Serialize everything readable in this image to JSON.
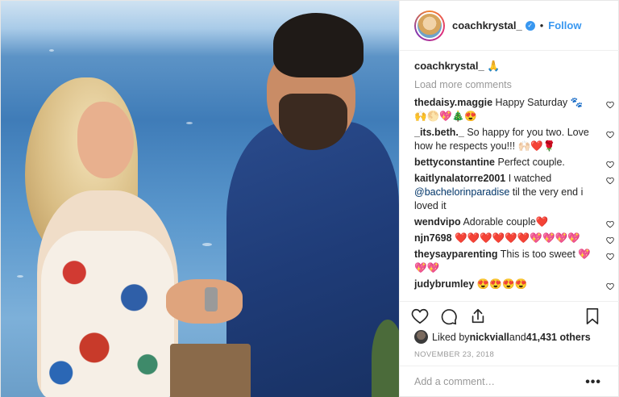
{
  "post": {
    "author": "coachkrystal_",
    "follow_label": "Follow",
    "separator": "•",
    "caption_user": "coachkrystal_",
    "caption_text": "🙏",
    "load_more": "Load more comments"
  },
  "comments": [
    {
      "user": "thedaisy.maggie",
      "text": "Happy Saturday 🐾 🙌🌕💖🎄😍"
    },
    {
      "user": "_its.beth._",
      "text": "So happy for you two. Love how he respects you!!! 🙌🏻❤️🌹"
    },
    {
      "user": "bettyconstantine",
      "text": "Perfect couple."
    },
    {
      "user": "kaitlynalatorre2001",
      "text_pre": "I watched ",
      "mention": "@bachelorinparadise",
      "text_post": " til the very end i loved it"
    },
    {
      "user": "wendvipo",
      "text": "Adorable couple❤️"
    },
    {
      "user": "njn7698",
      "text": "❤️❤️❤️❤️❤️❤️💖💖💖💖"
    },
    {
      "user": "theysayparenting",
      "text": "This is too sweet 💖💖💖"
    },
    {
      "user": "judybrumley",
      "text": "😍😍😍😍"
    }
  ],
  "likes": {
    "prefix": "Liked by ",
    "user": "nickviall",
    "middle": " and ",
    "count": "41,431 others"
  },
  "date": "NOVEMBER 23, 2018",
  "add_comment": {
    "placeholder": "Add a comment…",
    "more": "•••"
  },
  "icons": {
    "like": "heart-icon",
    "comment": "comment-icon",
    "share": "share-icon",
    "save": "bookmark-icon",
    "verified": "verified-badge-icon"
  },
  "colors": {
    "accent": "#3897f0",
    "text": "#262626",
    "muted": "#999999"
  }
}
